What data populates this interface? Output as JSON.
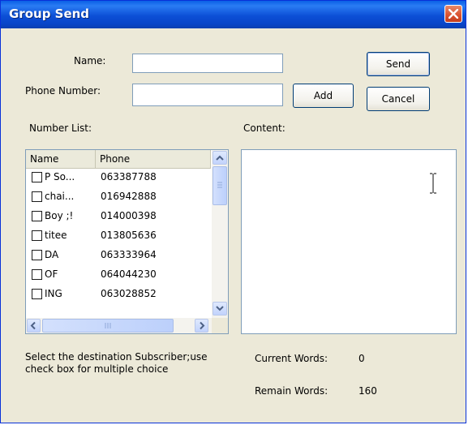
{
  "window": {
    "title": "Group Send"
  },
  "form": {
    "name_label": "Name:",
    "name_value": "",
    "phone_label": "Phone Number:",
    "phone_value": ""
  },
  "buttons": {
    "send": "Send",
    "add": "Add",
    "cancel": "Cancel"
  },
  "number_list": {
    "label": "Number List:",
    "columns": [
      "Name",
      "Phone"
    ],
    "rows": [
      {
        "name": "P So...",
        "phone": "063387788",
        "checked": false
      },
      {
        "name": "chai...",
        "phone": "016942888",
        "checked": false
      },
      {
        "name": "Boy ;!",
        "phone": "014000398",
        "checked": false
      },
      {
        "name": "titee",
        "phone": "013805636",
        "checked": false
      },
      {
        "name": "DA",
        "phone": "063333964",
        "checked": false
      },
      {
        "name": "OF",
        "phone": "064044230",
        "checked": false
      },
      {
        "name": "ING",
        "phone": "063028852",
        "checked": false
      }
    ]
  },
  "content": {
    "label": "Content:",
    "value": ""
  },
  "hint": "Select the destination Subscriber;use check box for multiple choice",
  "stats": {
    "current_words_label": "Current Words:",
    "current_words": "0",
    "remain_words_label": "Remain Words:",
    "remain_words": "160"
  }
}
